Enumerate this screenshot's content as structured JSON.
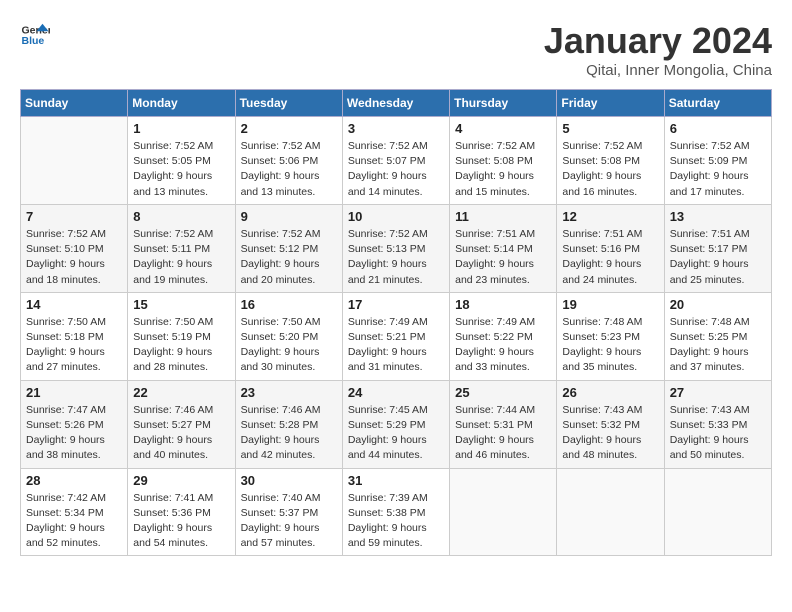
{
  "logo": {
    "line1": "General",
    "line2": "Blue"
  },
  "title": "January 2024",
  "subtitle": "Qitai, Inner Mongolia, China",
  "days_of_week": [
    "Sunday",
    "Monday",
    "Tuesday",
    "Wednesday",
    "Thursday",
    "Friday",
    "Saturday"
  ],
  "weeks": [
    [
      {
        "num": "",
        "info": ""
      },
      {
        "num": "1",
        "info": "Sunrise: 7:52 AM\nSunset: 5:05 PM\nDaylight: 9 hours\nand 13 minutes."
      },
      {
        "num": "2",
        "info": "Sunrise: 7:52 AM\nSunset: 5:06 PM\nDaylight: 9 hours\nand 13 minutes."
      },
      {
        "num": "3",
        "info": "Sunrise: 7:52 AM\nSunset: 5:07 PM\nDaylight: 9 hours\nand 14 minutes."
      },
      {
        "num": "4",
        "info": "Sunrise: 7:52 AM\nSunset: 5:08 PM\nDaylight: 9 hours\nand 15 minutes."
      },
      {
        "num": "5",
        "info": "Sunrise: 7:52 AM\nSunset: 5:08 PM\nDaylight: 9 hours\nand 16 minutes."
      },
      {
        "num": "6",
        "info": "Sunrise: 7:52 AM\nSunset: 5:09 PM\nDaylight: 9 hours\nand 17 minutes."
      }
    ],
    [
      {
        "num": "7",
        "info": "Sunrise: 7:52 AM\nSunset: 5:10 PM\nDaylight: 9 hours\nand 18 minutes."
      },
      {
        "num": "8",
        "info": "Sunrise: 7:52 AM\nSunset: 5:11 PM\nDaylight: 9 hours\nand 19 minutes."
      },
      {
        "num": "9",
        "info": "Sunrise: 7:52 AM\nSunset: 5:12 PM\nDaylight: 9 hours\nand 20 minutes."
      },
      {
        "num": "10",
        "info": "Sunrise: 7:52 AM\nSunset: 5:13 PM\nDaylight: 9 hours\nand 21 minutes."
      },
      {
        "num": "11",
        "info": "Sunrise: 7:51 AM\nSunset: 5:14 PM\nDaylight: 9 hours\nand 23 minutes."
      },
      {
        "num": "12",
        "info": "Sunrise: 7:51 AM\nSunset: 5:16 PM\nDaylight: 9 hours\nand 24 minutes."
      },
      {
        "num": "13",
        "info": "Sunrise: 7:51 AM\nSunset: 5:17 PM\nDaylight: 9 hours\nand 25 minutes."
      }
    ],
    [
      {
        "num": "14",
        "info": "Sunrise: 7:50 AM\nSunset: 5:18 PM\nDaylight: 9 hours\nand 27 minutes."
      },
      {
        "num": "15",
        "info": "Sunrise: 7:50 AM\nSunset: 5:19 PM\nDaylight: 9 hours\nand 28 minutes."
      },
      {
        "num": "16",
        "info": "Sunrise: 7:50 AM\nSunset: 5:20 PM\nDaylight: 9 hours\nand 30 minutes."
      },
      {
        "num": "17",
        "info": "Sunrise: 7:49 AM\nSunset: 5:21 PM\nDaylight: 9 hours\nand 31 minutes."
      },
      {
        "num": "18",
        "info": "Sunrise: 7:49 AM\nSunset: 5:22 PM\nDaylight: 9 hours\nand 33 minutes."
      },
      {
        "num": "19",
        "info": "Sunrise: 7:48 AM\nSunset: 5:23 PM\nDaylight: 9 hours\nand 35 minutes."
      },
      {
        "num": "20",
        "info": "Sunrise: 7:48 AM\nSunset: 5:25 PM\nDaylight: 9 hours\nand 37 minutes."
      }
    ],
    [
      {
        "num": "21",
        "info": "Sunrise: 7:47 AM\nSunset: 5:26 PM\nDaylight: 9 hours\nand 38 minutes."
      },
      {
        "num": "22",
        "info": "Sunrise: 7:46 AM\nSunset: 5:27 PM\nDaylight: 9 hours\nand 40 minutes."
      },
      {
        "num": "23",
        "info": "Sunrise: 7:46 AM\nSunset: 5:28 PM\nDaylight: 9 hours\nand 42 minutes."
      },
      {
        "num": "24",
        "info": "Sunrise: 7:45 AM\nSunset: 5:29 PM\nDaylight: 9 hours\nand 44 minutes."
      },
      {
        "num": "25",
        "info": "Sunrise: 7:44 AM\nSunset: 5:31 PM\nDaylight: 9 hours\nand 46 minutes."
      },
      {
        "num": "26",
        "info": "Sunrise: 7:43 AM\nSunset: 5:32 PM\nDaylight: 9 hours\nand 48 minutes."
      },
      {
        "num": "27",
        "info": "Sunrise: 7:43 AM\nSunset: 5:33 PM\nDaylight: 9 hours\nand 50 minutes."
      }
    ],
    [
      {
        "num": "28",
        "info": "Sunrise: 7:42 AM\nSunset: 5:34 PM\nDaylight: 9 hours\nand 52 minutes."
      },
      {
        "num": "29",
        "info": "Sunrise: 7:41 AM\nSunset: 5:36 PM\nDaylight: 9 hours\nand 54 minutes."
      },
      {
        "num": "30",
        "info": "Sunrise: 7:40 AM\nSunset: 5:37 PM\nDaylight: 9 hours\nand 57 minutes."
      },
      {
        "num": "31",
        "info": "Sunrise: 7:39 AM\nSunset: 5:38 PM\nDaylight: 9 hours\nand 59 minutes."
      },
      {
        "num": "",
        "info": ""
      },
      {
        "num": "",
        "info": ""
      },
      {
        "num": "",
        "info": ""
      }
    ]
  ]
}
